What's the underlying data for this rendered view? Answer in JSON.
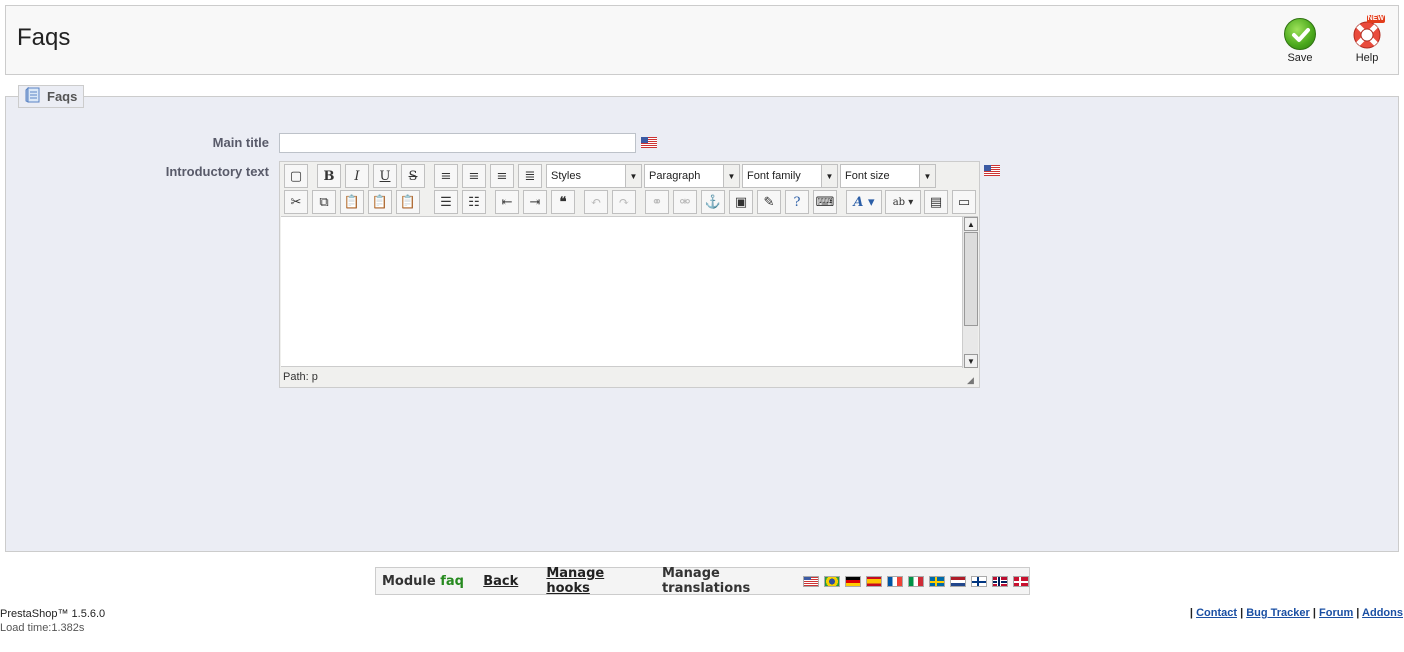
{
  "header": {
    "title": "Faqs",
    "save_label": "Save",
    "help_label": "Help",
    "help_badge": "NEW"
  },
  "fieldset": {
    "legend": "Faqs",
    "main_title_label": "Main title",
    "main_title_value": "",
    "intro_label": "Introductory text"
  },
  "editor": {
    "styles_value": "Styles",
    "format_value": "Paragraph",
    "font_family_value": "Font family",
    "font_size_value": "Font size",
    "path_text": "Path: p"
  },
  "module_bar": {
    "module_prefix": "Module",
    "module_name": "faq",
    "back_label": "Back",
    "hooks_label": "Manage hooks",
    "translations_label": "Manage translations"
  },
  "footer": {
    "version": "PrestaShop™ 1.5.6.0",
    "load_time": "Load time:1.382s",
    "links": [
      "Contact",
      "Bug Tracker",
      "Forum",
      "Addons"
    ]
  },
  "colors": {
    "fieldset_bg": "#ebedf4",
    "save_green": "#4aa81c",
    "module_green": "#268a1f",
    "link_blue": "#1a4fa3"
  }
}
